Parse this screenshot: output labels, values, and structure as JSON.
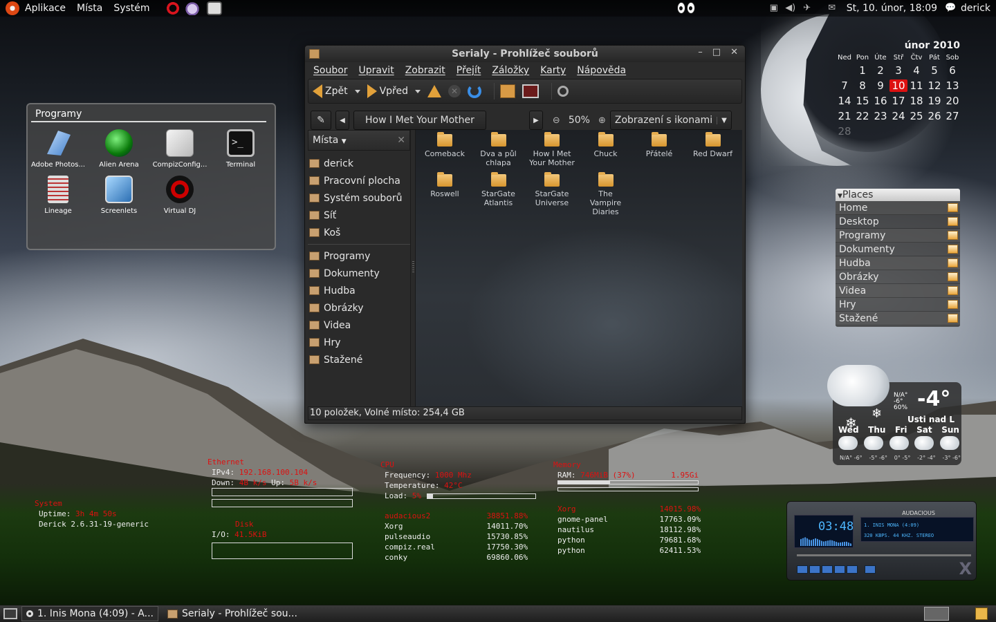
{
  "top_panel": {
    "menus": [
      "Aplikace",
      "Místa",
      "Systém"
    ],
    "clock": "St, 10. únor, 18:09",
    "user": "derick"
  },
  "calendar": {
    "title": "únor 2010",
    "weekdays": [
      "Ned",
      "Pon",
      "Úte",
      "Stř",
      "Čtv",
      "Pát",
      "Sob"
    ],
    "days": [
      "1",
      "2",
      "3",
      "4",
      "5",
      "6",
      "7",
      "8",
      "9",
      "10",
      "11",
      "12",
      "13",
      "14",
      "15",
      "16",
      "17",
      "18",
      "19",
      "20",
      "21",
      "22",
      "23",
      "24",
      "25",
      "26",
      "27",
      "28"
    ],
    "today": "10"
  },
  "programs": {
    "title": "Programy",
    "apps": [
      {
        "label": "Adobe Photos...",
        "icon": "photoshop-icon"
      },
      {
        "label": "Alien Arena",
        "icon": "alien-arena-icon"
      },
      {
        "label": "CompizConfig...",
        "icon": "compizconfig-icon"
      },
      {
        "label": "Terminal",
        "icon": "terminal-icon"
      },
      {
        "label": "Lineage",
        "icon": "lineage-icon"
      },
      {
        "label": "Screenlets",
        "icon": "screenlets-icon"
      },
      {
        "label": "Virtual DJ",
        "icon": "virtual-dj-icon"
      }
    ]
  },
  "window": {
    "title": "Serialy - Prohlížeč souborů",
    "menu": [
      "Soubor",
      "Upravit",
      "Zobrazit",
      "Přejít",
      "Záložky",
      "Karty",
      "Nápověda"
    ],
    "toolbar": {
      "back": "Zpět",
      "forward": "Vpřed"
    },
    "location": {
      "path_button": "How I Met Your Mother",
      "zoom": "50%",
      "view": "Zobrazení s ikonami"
    },
    "sidebar": {
      "header": "Místa",
      "items_top": [
        "derick",
        "Pracovní plocha",
        "Systém souborů",
        "Síť",
        "Koš"
      ],
      "items_bottom": [
        "Programy",
        "Dokumenty",
        "Hudba",
        "Obrázky",
        "Videa",
        "Hry",
        "Stažené"
      ]
    },
    "files": [
      {
        "l1": "Comeback",
        "l2": "",
        "l3": ""
      },
      {
        "l1": "Dva a půl",
        "l2": "chlapa",
        "l3": ""
      },
      {
        "l1": "How I Met",
        "l2": "Your Mother",
        "l3": ""
      },
      {
        "l1": "Chuck",
        "l2": "",
        "l3": ""
      },
      {
        "l1": "Přátelé",
        "l2": "",
        "l3": ""
      },
      {
        "l1": "Red Dwarf",
        "l2": "",
        "l3": ""
      },
      {
        "l1": "Roswell",
        "l2": "",
        "l3": ""
      },
      {
        "l1": "StarGate",
        "l2": "Atlantis",
        "l3": ""
      },
      {
        "l1": "StarGate",
        "l2": "Universe",
        "l3": ""
      },
      {
        "l1": "The",
        "l2": "Vampire",
        "l3": "Diaries"
      }
    ],
    "status": "10 položek, Volné místo: 254,4 GB"
  },
  "places": {
    "title": "Places",
    "items": [
      "Home",
      "Desktop",
      "Programy",
      "Dokumenty",
      "Hudba",
      "Obrázky",
      "Videa",
      "Hry",
      "Stažené"
    ]
  },
  "weather": {
    "temp": "-4°",
    "na_lines": [
      "N/A°",
      "-6°",
      "60%"
    ],
    "city": "Usti nad L",
    "days": [
      "Wed",
      "Thu",
      "Fri",
      "Sat",
      "Sun"
    ],
    "temps": [
      "N/A° -6°",
      "-5° -6°",
      "0° -5°",
      "-2° -4°",
      "-3° -6°"
    ]
  },
  "conky": {
    "system": {
      "header": "System",
      "uptime_label": "Uptime:",
      "uptime": "3h 4m 50s",
      "kernel": "Derick 2.6.31-19-generic"
    },
    "ethernet": {
      "header": "Ethernet",
      "ipv4_label": "IPv4:",
      "ipv4": "192.168.100.104",
      "down_label": "Down:",
      "down": "4B   k/s",
      "up_label": "Up:",
      "up": "5B   k/s"
    },
    "disk": {
      "header": "Disk",
      "io_label": "I/O:",
      "io": "41.5KiB"
    },
    "cpu": {
      "header": "CPU",
      "freq_label": "Frequency:",
      "freq": "1000 Mhz",
      "temp_label": "Temperature:",
      "temp": "42°C",
      "load_label": "Load:",
      "load": "5%",
      "load_fraction": 0.05,
      "procs": [
        {
          "name": "audacious2",
          "pid": "3885",
          "pct": "1.88%",
          "red": true
        },
        {
          "name": "Xorg",
          "pid": "1401",
          "pct": "1.70%",
          "red": false
        },
        {
          "name": "pulseaudio",
          "pid": "1573",
          "pct": "0.85%",
          "red": false
        },
        {
          "name": "compiz.real",
          "pid": "1775",
          "pct": "0.30%",
          "red": false
        },
        {
          "name": "conky",
          "pid": "6986",
          "pct": "0.06%",
          "red": false
        }
      ]
    },
    "memory": {
      "header": "Memory",
      "ram_label": "RAM:",
      "ram": "746MiB (37%)",
      "total": "1.95Gi",
      "ram_fraction": 0.37,
      "procs": [
        {
          "name": "Xorg",
          "pid": "1401",
          "pct": "5.98%",
          "red": true
        },
        {
          "name": "gnome-panel",
          "pid": "1776",
          "pct": "3.09%",
          "red": false
        },
        {
          "name": "nautilus",
          "pid": "1811",
          "pct": "2.98%",
          "red": false
        },
        {
          "name": "python",
          "pid": "7968",
          "pct": "1.68%",
          "red": false
        },
        {
          "name": "python",
          "pid": "6241",
          "pct": "1.53%",
          "red": false
        }
      ]
    }
  },
  "audacious": {
    "time": "03:48",
    "title": "AUDACIOUS",
    "track": "1. INIS MONA (4:09)",
    "info": "320 KBPS. 44 KHZ. STEREO"
  },
  "bottom_panel": {
    "tasks": [
      "1. Inis Mona (4:09) - A...",
      "Serialy - Prohlížeč sou..."
    ]
  }
}
